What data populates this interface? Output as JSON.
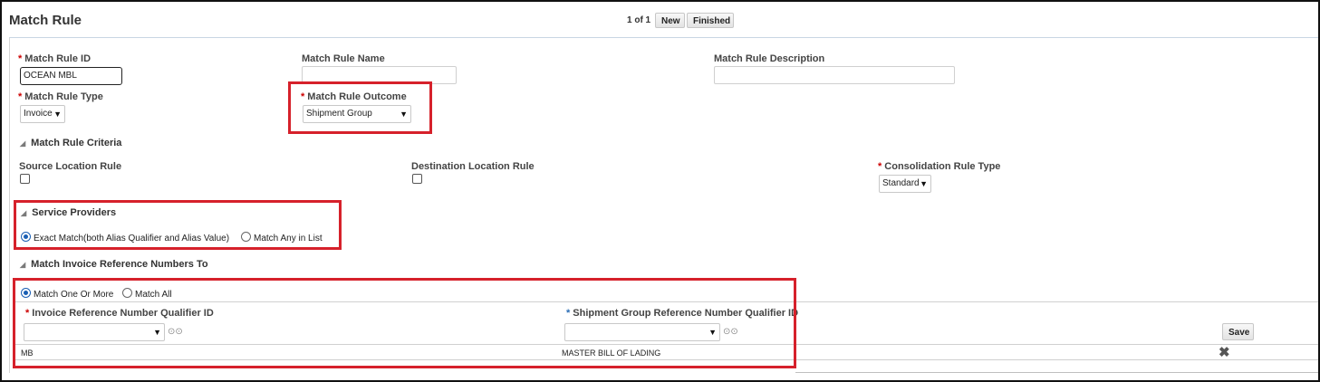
{
  "header": {
    "title": "Match Rule",
    "pager": "1 of 1",
    "new_label": "New",
    "finished_label": "Finished"
  },
  "fields": {
    "match_rule_id_label": "Match Rule ID",
    "match_rule_id_value": "OCEAN MBL",
    "match_rule_name_label": "Match Rule Name",
    "match_rule_name_value": "",
    "match_rule_description_label": "Match Rule Description",
    "match_rule_description_value": "",
    "match_rule_type_label": "Match Rule Type",
    "match_rule_type_value": "Invoice",
    "match_rule_outcome_label": "Match Rule Outcome",
    "match_rule_outcome_value": "Shipment Group"
  },
  "criteria": {
    "title": "Match Rule Criteria",
    "source_location_label": "Source Location Rule",
    "destination_location_label": "Destination Location Rule",
    "consolidation_label": "Consolidation Rule Type",
    "consolidation_value": "Standard"
  },
  "service_providers": {
    "title": "Service Providers",
    "options": [
      "Exact Match(both Alias Qualifier and Alias Value)",
      "Match Any in List"
    ],
    "selected": 0
  },
  "invoice_ref": {
    "title": "Match Invoice Reference Numbers To",
    "options": [
      "Match One Or More",
      "Match All"
    ],
    "selected": 0,
    "col1_header": "Invoice Reference Number Qualifier ID",
    "col2_header": "Shipment Group Reference Number Qualifier ID",
    "save_label": "Save",
    "rows": [
      {
        "col1": "MB",
        "col2": "MASTER BILL OF LADING"
      }
    ]
  },
  "icons": {
    "lookup": "glasses-icon",
    "delete": "x-delete-icon",
    "collapse": "collapse-triangle-icon",
    "dropdown": "chevron-down-icon"
  },
  "colors": {
    "highlight_box": "#d6212b",
    "required_star": "#cc0000",
    "radio_selected": "#1a5fb4"
  }
}
